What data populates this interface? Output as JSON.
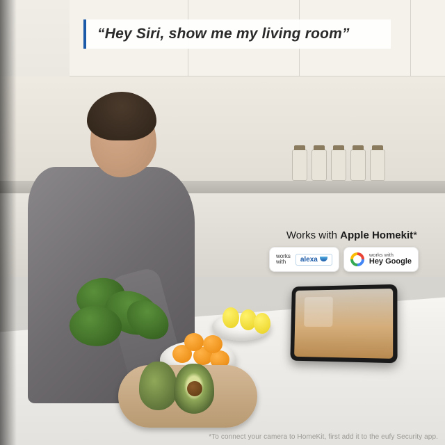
{
  "speech": {
    "text": "“Hey Siri, show me my living room”"
  },
  "works_with": {
    "title_prefix": "Works with ",
    "title_bold": "Apple Homekit",
    "title_suffix": "*",
    "alexa": {
      "line1": "works",
      "line2": "with",
      "brand": "alexa"
    },
    "google": {
      "line1": "works with",
      "line2": "Hey Google"
    }
  },
  "footnote": "*To connect your camera to HomeKit, first add it to the eufy Security app."
}
